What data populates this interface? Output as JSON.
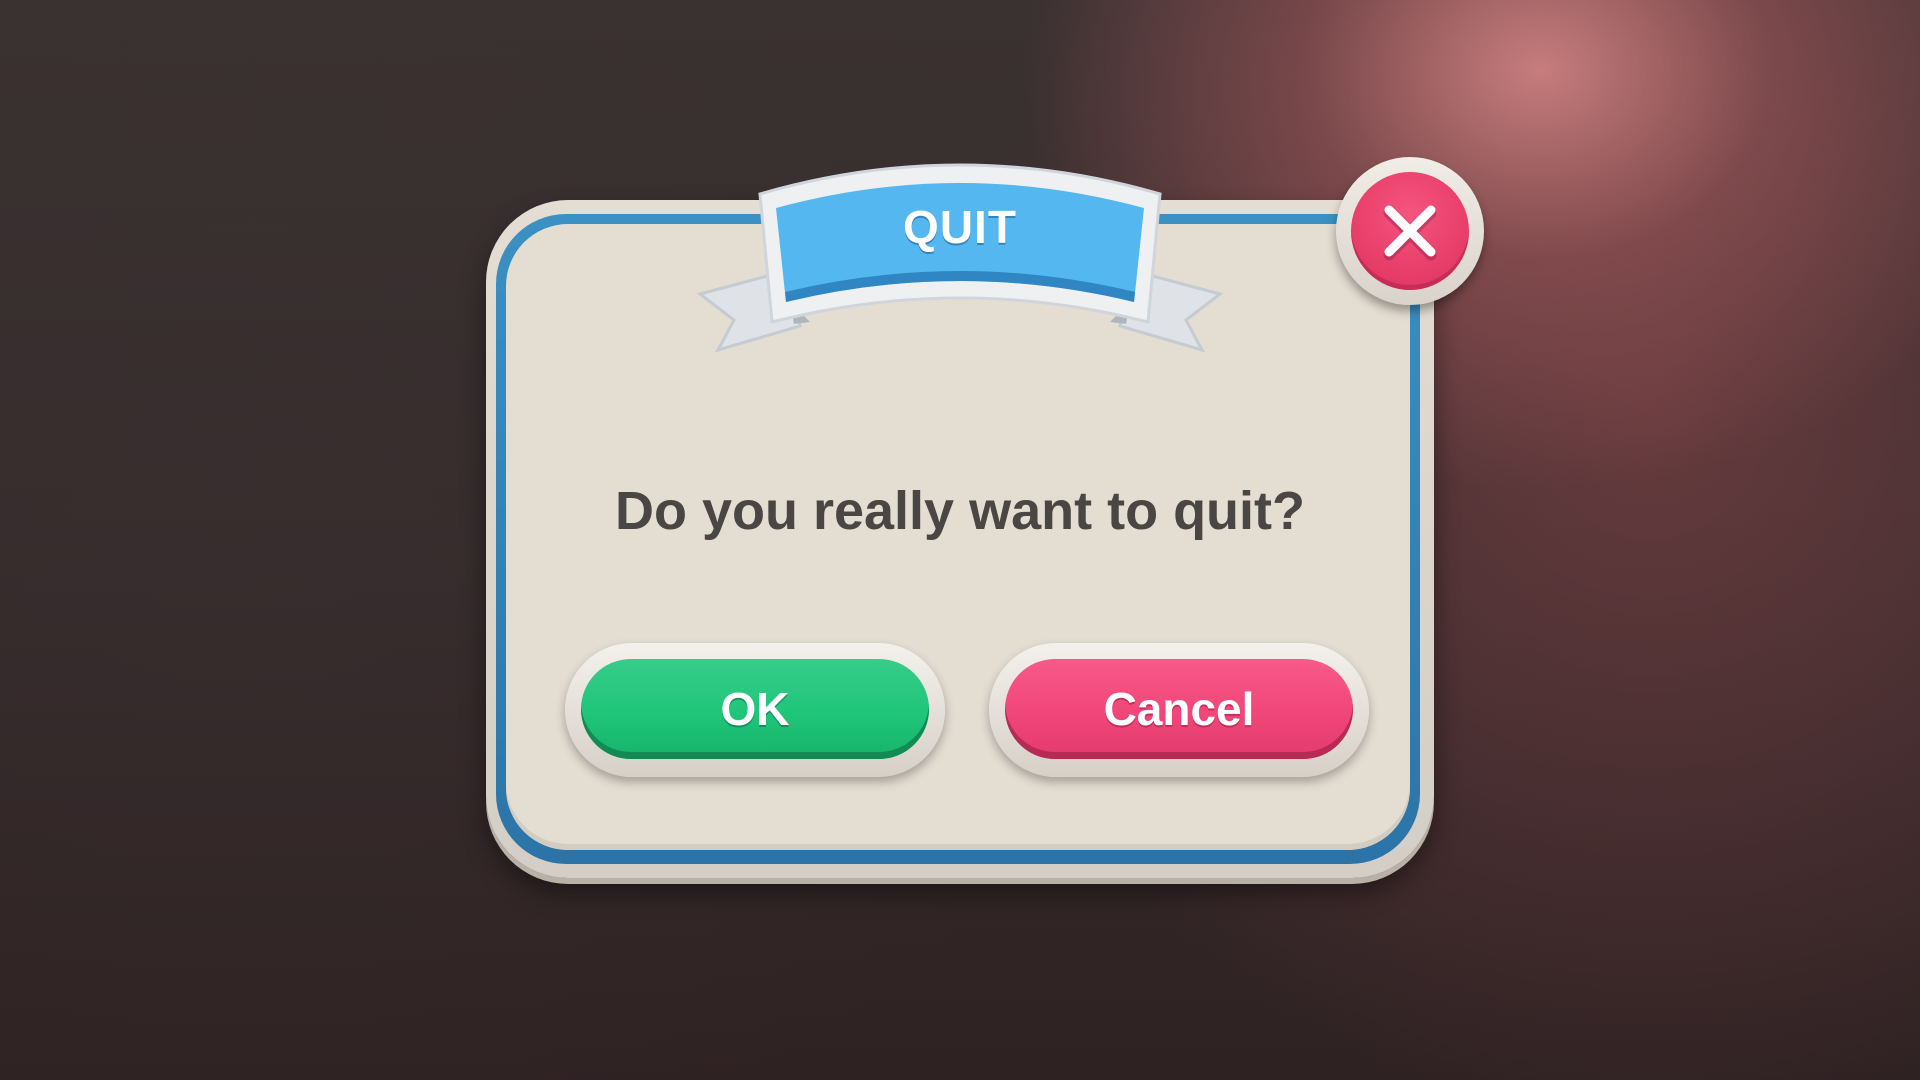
{
  "dialog": {
    "banner_title": "QUIT",
    "message": "Do you really want to quit?",
    "close_icon": "close-icon"
  },
  "buttons": {
    "ok_label": "OK",
    "cancel_label": "Cancel"
  },
  "colors": {
    "banner_blue": "#55b6ef",
    "panel_border_blue": "#2f7eb3",
    "panel_fill": "#e3ddd2",
    "ok_green": "#1fc57a",
    "cancel_pink": "#f04679",
    "close_pink": "#e83e6a",
    "message_text": "#4a4643"
  }
}
